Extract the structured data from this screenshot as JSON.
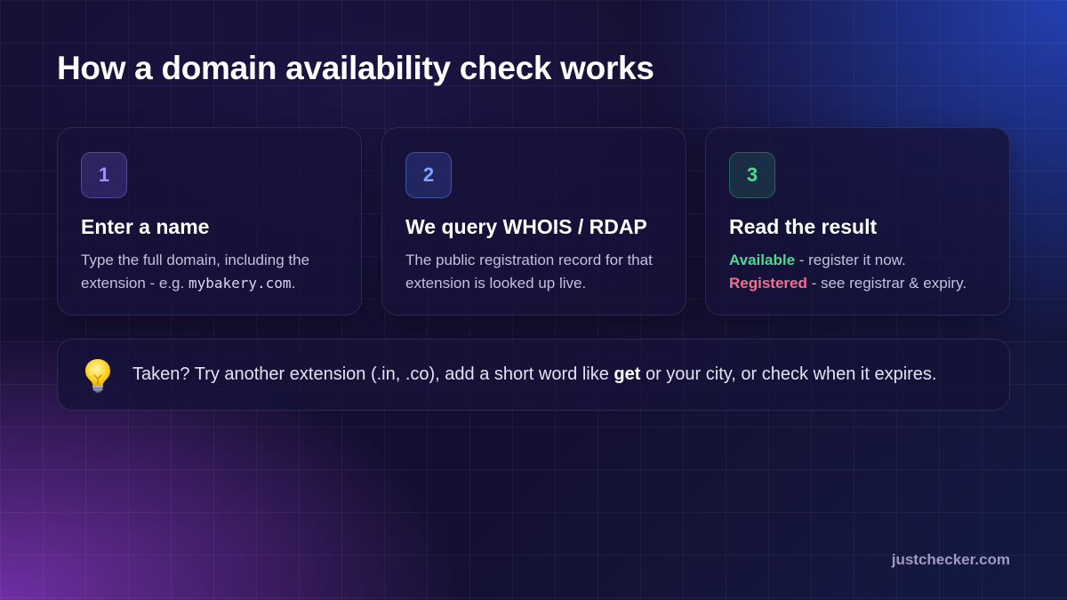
{
  "title": "How a domain availability check works",
  "steps": [
    {
      "number": "1",
      "title": "Enter a name",
      "text_before": "Type the full domain, including the extension - e.g. ",
      "example": "mybakery.com",
      "text_after": "."
    },
    {
      "number": "2",
      "title": "We query WHOIS / RDAP",
      "text": "The public registration record for that extension is looked up live."
    },
    {
      "number": "3",
      "title": "Read the result",
      "available_label": "Available",
      "available_text": " - register it now.",
      "registered_label": "Registered",
      "registered_text": " - see registrar & expiry."
    }
  ],
  "tip": {
    "icon": "lightbulb-icon",
    "text_before": "Taken? Try another extension (.in, .co), add a short word like ",
    "keyword": "get",
    "text_after": " or your city, or check when it expires."
  },
  "footer": "justchecker.com",
  "colors": {
    "available": "#4ed991",
    "registered": "#f0708e",
    "step1": "#a88dff",
    "step2": "#7ea6ff",
    "step3": "#4ed991"
  }
}
